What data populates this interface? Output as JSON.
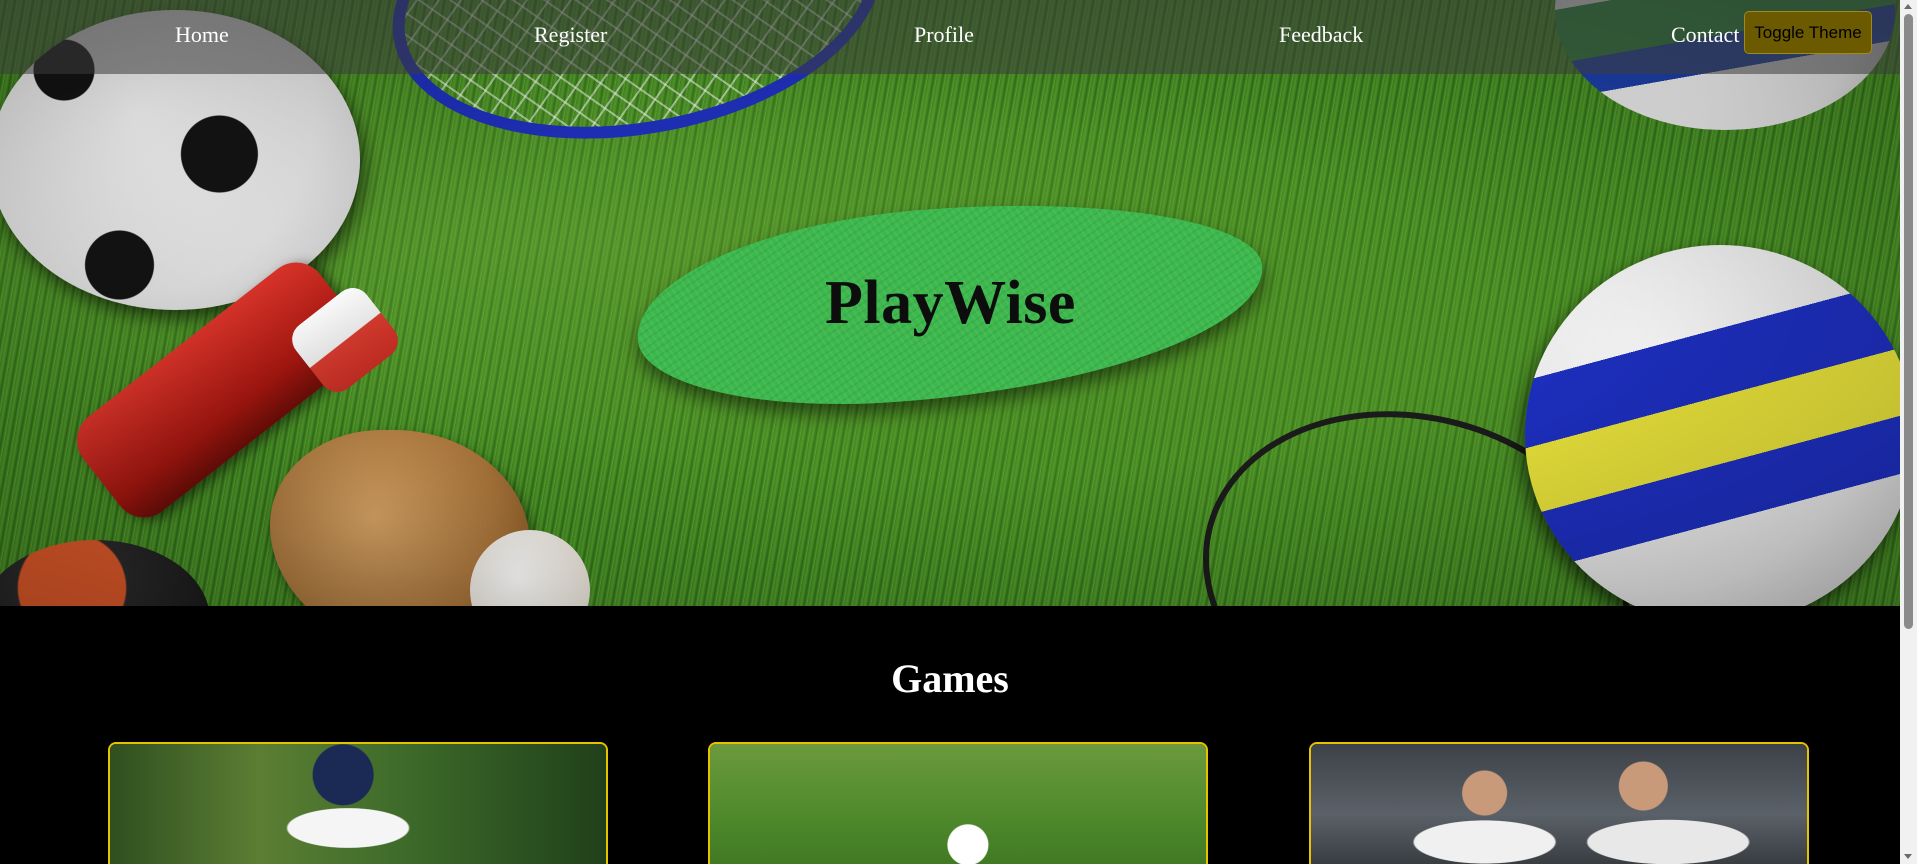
{
  "nav": {
    "home": "Home",
    "register": "Register",
    "profile": "Profile",
    "feedback": "Feedback",
    "contact": "Contact Us"
  },
  "theme_toggle_label": "Toggle Theme",
  "hero": {
    "title": "PlayWise"
  },
  "games": {
    "heading": "Games",
    "cards": [
      {
        "image_subject": "cricket-batsman"
      },
      {
        "image_subject": "golf-ball-on-grass"
      },
      {
        "image_subject": "football-players"
      }
    ]
  },
  "colors": {
    "page_background": "#000000",
    "nav_text": "#ffffff",
    "title_blob": "#3cb84d",
    "card_border": "#e6c200",
    "toggle_background": "#6b5a00"
  }
}
